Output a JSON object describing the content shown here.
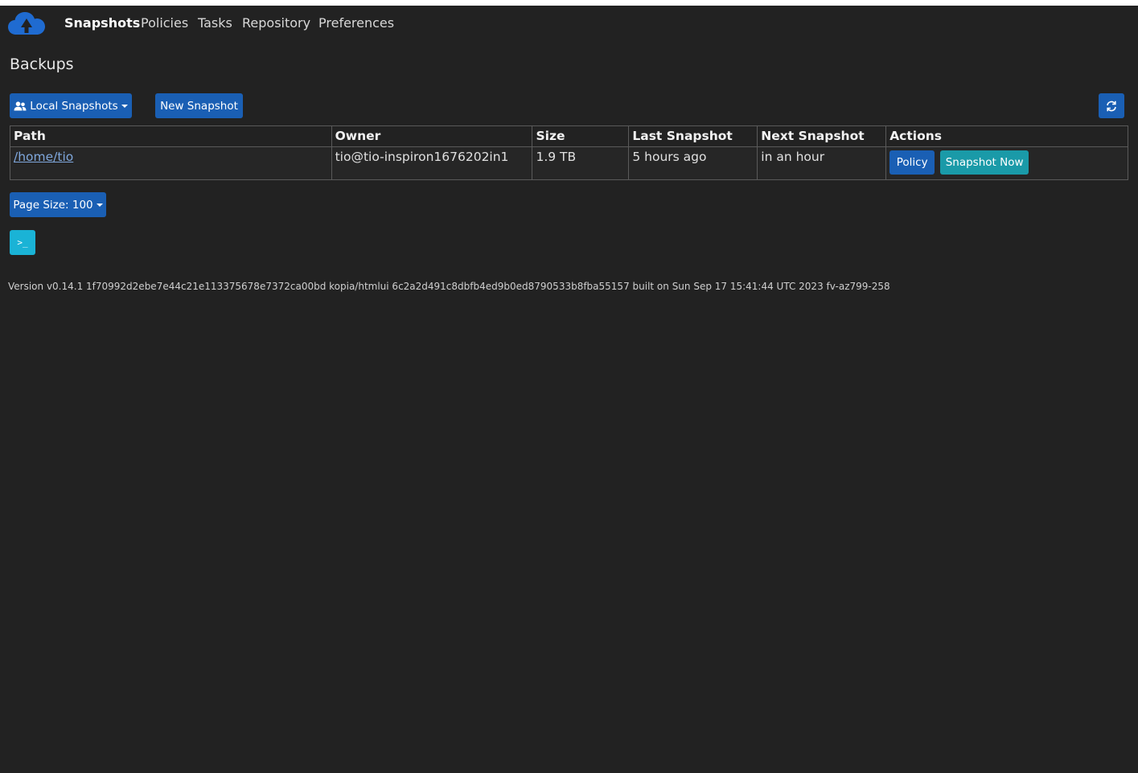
{
  "colors": {
    "background": "#222222",
    "primary": "#1a5fb4",
    "info": "#1a9aa8",
    "terminal": "#1ab3d6",
    "link": "#7fa7dc"
  },
  "nav": {
    "logo_icon": "cloud-upload-icon",
    "items": [
      {
        "label": "Snapshots",
        "active": true
      },
      {
        "label": "Policies",
        "active": false
      },
      {
        "label": "Tasks",
        "active": false
      },
      {
        "label": "Repository",
        "active": false
      },
      {
        "label": "Preferences",
        "active": false
      }
    ]
  },
  "page": {
    "title": "Backups"
  },
  "toolbar": {
    "owner_dropdown_label": "Local Snapshots",
    "owner_dropdown_icon": "users-icon",
    "new_snapshot_label": "New Snapshot",
    "refresh_icon": "refresh-icon"
  },
  "table": {
    "headers": [
      "Path",
      "Owner",
      "Size",
      "Last Snapshot",
      "Next Snapshot",
      "Actions"
    ],
    "rows": [
      {
        "path": "/home/tio",
        "owner": "tio@tio-inspiron1676202in1",
        "size": "1.9 TB",
        "last_snapshot": "5 hours ago",
        "next_snapshot": "in an hour",
        "policy_label": "Policy",
        "snapshot_now_label": "Snapshot Now"
      }
    ]
  },
  "pagination": {
    "page_size_label": "Page Size: 100"
  },
  "terminal": {
    "icon": "terminal-icon",
    "glyph": ">_"
  },
  "footer": {
    "version_text": "Version v0.14.1 1f70992d2ebe7e44c21e113375678e7372ca00bd kopia/htmlui 6c2a2d491c8dbfb4ed9b0ed8790533b8fba55157 built on Sun Sep 17 15:41:44 UTC 2023 fv-az799-258"
  }
}
